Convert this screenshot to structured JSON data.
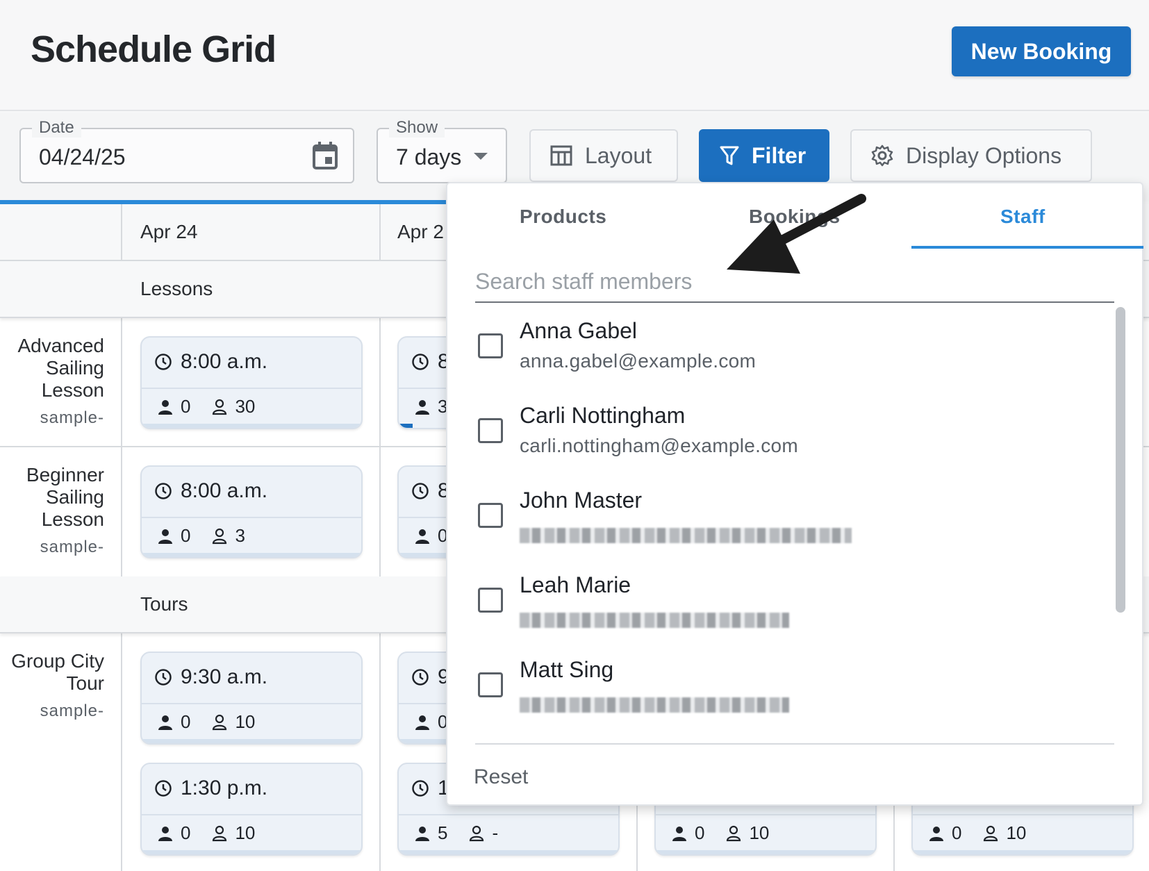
{
  "header": {
    "title": "Schedule Grid",
    "new_booking_label": "New Booking"
  },
  "toolbar": {
    "date_label": "Date",
    "date_value": "04/24/25",
    "show_label": "Show",
    "show_value": "7 days",
    "layout_label": "Layout",
    "filter_label": "Filter",
    "display_options_label": "Display Options"
  },
  "grid": {
    "columns": [
      "Apr 24",
      "Apr 2"
    ],
    "sections": [
      {
        "label": "Lessons",
        "rows": [
          {
            "name": "Advanced Sailing Lesson",
            "sub": "sample-",
            "cards": [
              {
                "time": "8:00 a.m.",
                "booked": "0",
                "capacity": "30"
              },
              {
                "time": "8",
                "booked": "3",
                "capacity": ""
              }
            ]
          },
          {
            "name": "Beginner Sailing Lesson",
            "sub": "sample-",
            "cards": [
              {
                "time": "8:00 a.m.",
                "booked": "0",
                "capacity": "3"
              },
              {
                "time": "8",
                "booked": "0",
                "capacity": ""
              }
            ]
          }
        ]
      },
      {
        "label": "Tours",
        "rows": [
          {
            "name": "Group City Tour",
            "sub": "sample-",
            "cards": [
              {
                "time": "9:30 a.m.",
                "booked": "0",
                "capacity": "10"
              },
              {
                "time": "9",
                "booked": "0",
                "capacity": ""
              },
              {
                "time": "1:30 p.m.",
                "booked": "0",
                "capacity": "10"
              },
              {
                "time": "1:",
                "booked": "5",
                "capacity": "-"
              },
              {
                "time": "",
                "booked": "0",
                "capacity": "10"
              },
              {
                "time": "",
                "booked": "0",
                "capacity": "10"
              }
            ]
          }
        ]
      }
    ]
  },
  "filter_panel": {
    "tabs": [
      "Products",
      "Bookings",
      "Staff"
    ],
    "active_tab": "Staff",
    "search_placeholder": "Search staff members",
    "staff": [
      {
        "name": "Anna Gabel",
        "email": "anna.gabel@example.com"
      },
      {
        "name": "Carli Nottingham",
        "email": "carli.nottingham@example.com"
      },
      {
        "name": "John Master",
        "email": ""
      },
      {
        "name": "Leah Marie",
        "email": ""
      },
      {
        "name": "Matt Sing",
        "email": ""
      }
    ],
    "reset_label": "Reset"
  },
  "colors": {
    "primary": "#1c6fbf",
    "accent": "#2b8ad9",
    "card_bg": "#edf2f8"
  }
}
